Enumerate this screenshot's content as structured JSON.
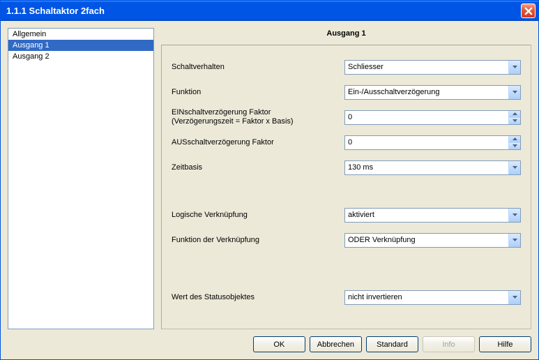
{
  "window": {
    "title": "1.1.1 Schaltaktor 2fach"
  },
  "sidebar": {
    "items": [
      {
        "label": "Allgemein",
        "selected": false
      },
      {
        "label": "Ausgang 1",
        "selected": true
      },
      {
        "label": "Ausgang 2",
        "selected": false
      }
    ]
  },
  "content": {
    "title": "Ausgang 1",
    "rows": [
      {
        "label": "Schaltverhalten",
        "type": "combo",
        "value": "Schliesser"
      },
      {
        "label": "Funktion",
        "type": "combo",
        "value": "Ein-/Ausschaltverzögerung"
      },
      {
        "label": "EINschaltverzögerung Faktor\n(Verzögerungszeit = Faktor x Basis)",
        "type": "spinner",
        "value": "0"
      },
      {
        "label": "AUSschaltverzögerung Faktor",
        "type": "spinner",
        "value": "0"
      },
      {
        "label": "Zeitbasis",
        "type": "combo",
        "value": "130 ms"
      },
      {
        "label": "Logische Verknüpfung",
        "type": "combo",
        "value": "aktiviert",
        "gap": "above"
      },
      {
        "label": "Funktion der Verknüpfung",
        "type": "combo",
        "value": "ODER Verknüpfung"
      },
      {
        "label": "Wert des Statusobjektes",
        "type": "combo",
        "value": "nicht invertieren",
        "gap": "above-big"
      }
    ]
  },
  "buttons": {
    "ok": "OK",
    "cancel": "Abbrechen",
    "standard": "Standard",
    "info": "Info",
    "help": "Hilfe"
  }
}
